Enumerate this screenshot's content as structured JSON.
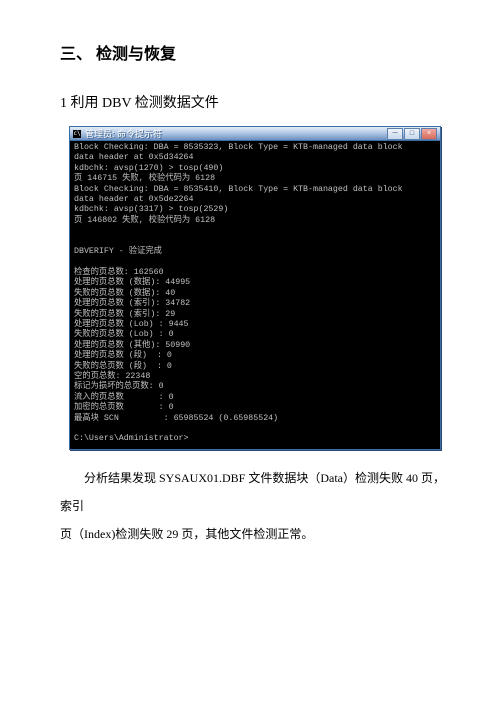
{
  "heading1": "三、  检测与恢复",
  "heading2": "1  利用 DBV 检测数据文件",
  "terminal": {
    "title_prefix": "管理员:",
    "title_text": "命令提示符",
    "btn_min": "─",
    "btn_max": "□",
    "btn_close": "×",
    "lines": [
      "Block Checking: DBA = 8535323, Block Type = KTB-managed data block",
      "data header at 0x5d34264",
      "kdbchk: avsp(1270) > tosp(490)",
      "页 146715 失败, 校验代码为 6128",
      "Block Checking: DBA = 8535410, Block Type = KTB-managed data block",
      "data header at 0x5de2264",
      "kdbchk: avsp(3317) > tosp(2529)",
      "页 146802 失败, 校验代码为 6128",
      "",
      "",
      "DBVERIFY - 验证完成",
      "",
      "检查的页总数: 162560",
      "处理的页总数 (数据): 44995",
      "失败的页总数 (数据): 40",
      "处理的页总数 (索引): 34782",
      "失败的页总数 (索引): 29",
      "处理的页总数 (Lob) : 9445",
      "失败的页总数 (Lob) : 0",
      "处理的页总数 (其他): 50990",
      "处理的页总数 (段)  : 0",
      "失败的总页数 (段)  : 0",
      "空的页总数: 22348",
      "标记为损坏的总页数: 0",
      "流入的页总数       : 0",
      "加密的总页数       : 0",
      "最高块 SCN         : 65985524 (0.65985524)",
      "",
      "C:\\Users\\Administrator>"
    ]
  },
  "para1": "分析结果发现 SYSAUX01.DBF 文件数据块（Data）检测失败 40 页，索引",
  "para2": "页（Index)检测失败 29 页，其他文件检测正常。"
}
